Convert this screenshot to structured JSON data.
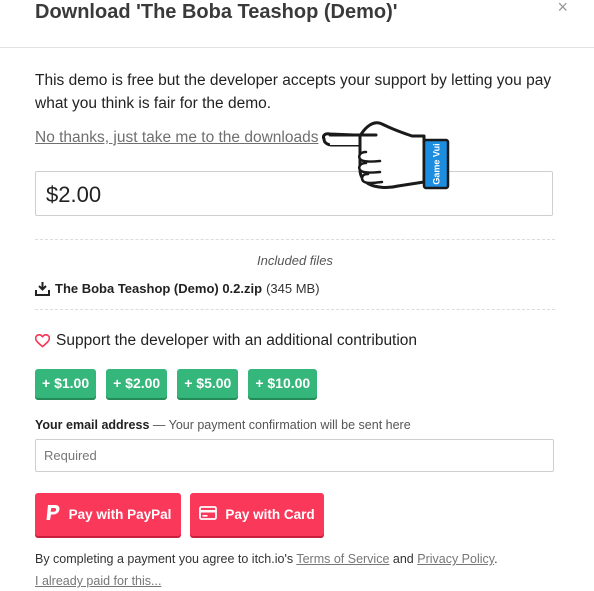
{
  "header": {
    "title": "Download 'The Boba Teashop (Demo)'",
    "close_glyph": "×"
  },
  "intro_text": "This demo is free but the developer accepts your support by letting you pay what you think is fair for the demo.",
  "no_thanks_link": "No thanks, just take me to the downloads",
  "price": {
    "value": "$2.00"
  },
  "watermark": {
    "badge_text": "Game Vui"
  },
  "files": {
    "heading": "Included files",
    "items": [
      {
        "name": "The Boba Teashop (Demo) 0.2.zip",
        "size": "(345 MB)",
        "icon": "download-icon"
      }
    ]
  },
  "support": {
    "text": "Support the developer with an additional contribution",
    "icon": "heart-icon",
    "tips": [
      "+ $1.00",
      "+ $2.00",
      "+ $5.00",
      "+ $10.00"
    ]
  },
  "email": {
    "label_strong": "Your email address",
    "label_rest": " — Your payment confirmation will be sent here",
    "placeholder": "Required",
    "value": ""
  },
  "payment": {
    "paypal_label": "Pay with PayPal",
    "card_label": "Pay with Card"
  },
  "legal": {
    "prefix": "By completing a payment you agree to itch.io's ",
    "terms": "Terms of Service",
    "and": " and ",
    "privacy": "Privacy Policy",
    "suffix": "."
  },
  "already_paid": "I already paid for this...",
  "colors": {
    "accent": "#fa385a",
    "tip_green": "#35b67a",
    "badge_blue": "#1d8de0"
  }
}
